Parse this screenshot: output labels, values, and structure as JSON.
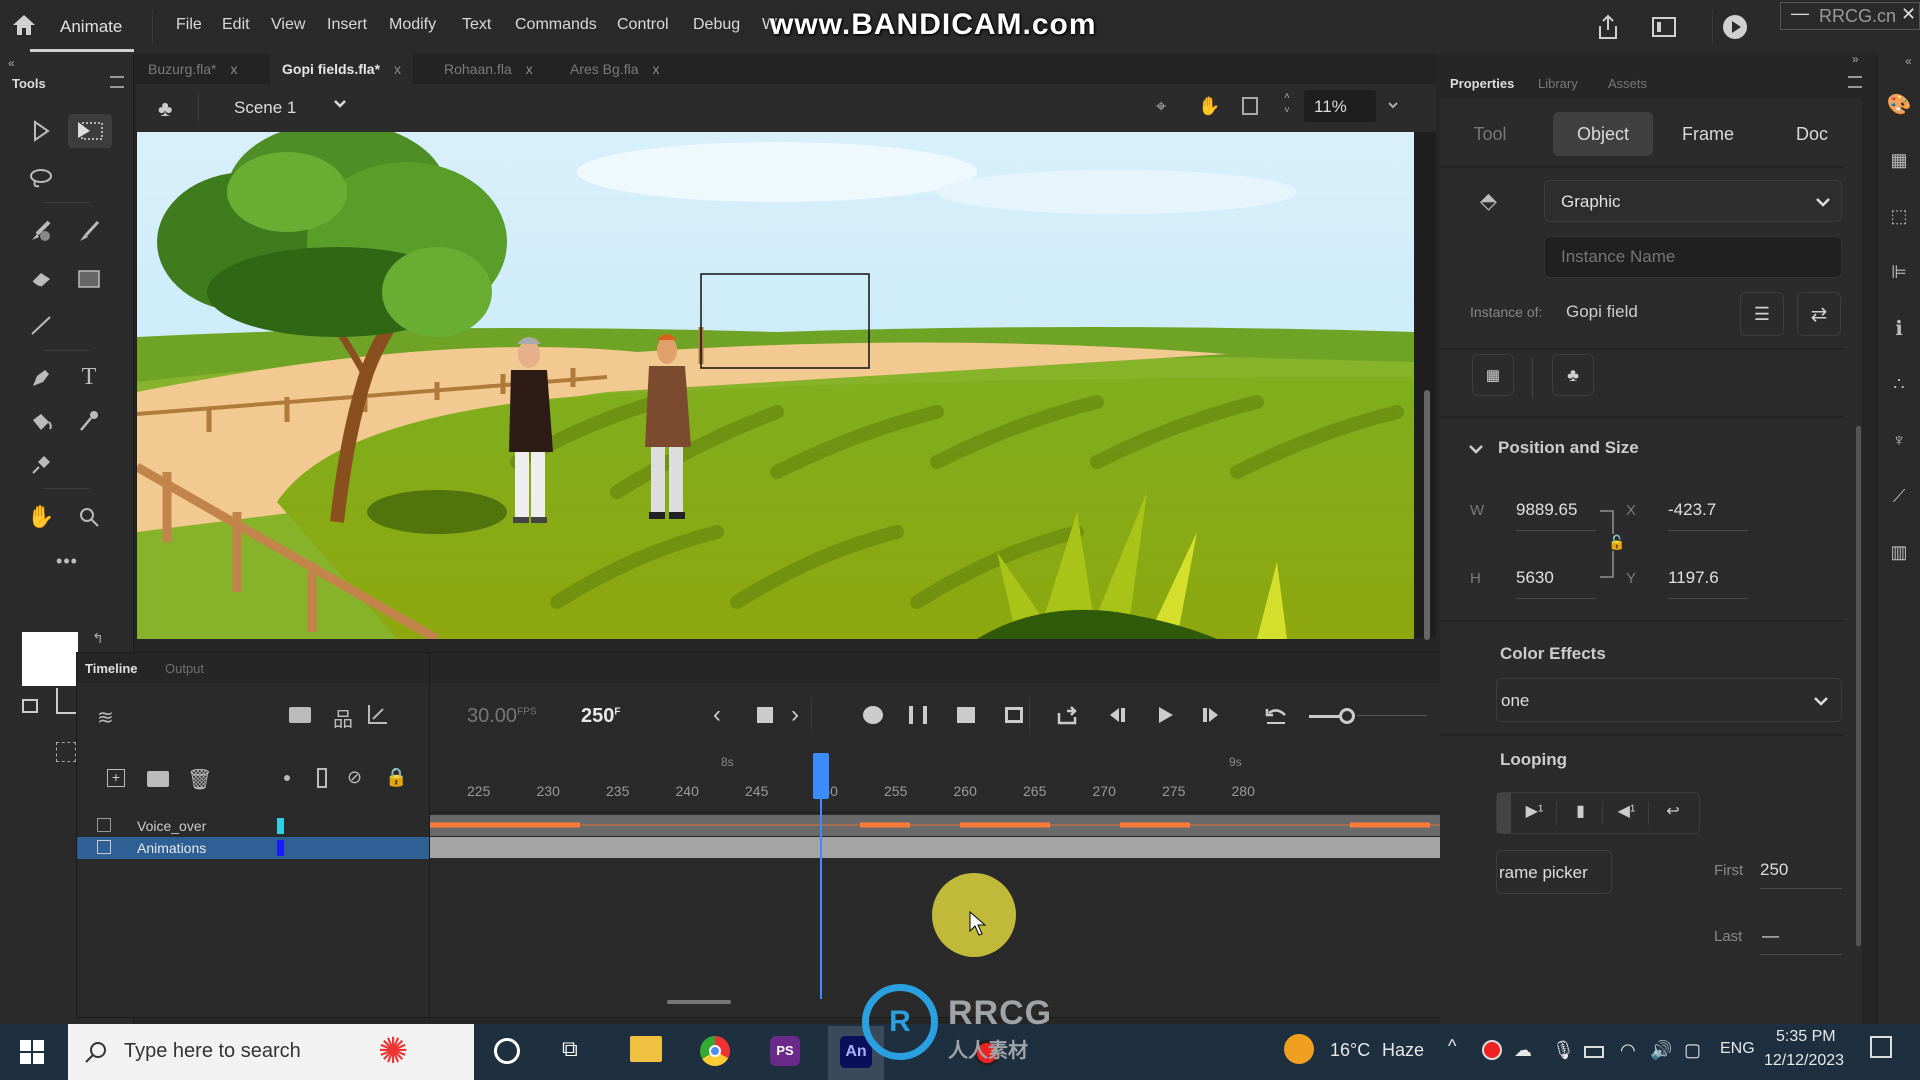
{
  "app": {
    "name": "Animate",
    "menu": [
      "File",
      "Edit",
      "View",
      "Insert",
      "Modify",
      "Text",
      "Commands",
      "Control",
      "Debug",
      "W"
    ],
    "watermark": "www.BANDICAM.com",
    "corner_watermark": "RRCG.cn"
  },
  "tools_panel": {
    "title": "Tools"
  },
  "doc_tabs": [
    {
      "label": "Buzurg.fla*",
      "active": false
    },
    {
      "label": "Gopi fields.fla*",
      "active": true
    },
    {
      "label": "Rohaan.fla",
      "active": false
    },
    {
      "label": "Ares Bg.fla",
      "active": false
    }
  ],
  "scene": {
    "label": "Scene 1",
    "zoom": "11%"
  },
  "timeline": {
    "tabs": [
      "Timeline",
      "Output"
    ],
    "fps": "30.00",
    "fps_unit": "FPS",
    "frame": "250",
    "frame_unit": "F",
    "seconds_markers": [
      "8s",
      "9s"
    ],
    "frame_ticks": [
      "225",
      "230",
      "235",
      "240",
      "245",
      "250",
      "255",
      "260",
      "265",
      "270",
      "275",
      "280"
    ],
    "current_frame": 250,
    "layers": [
      {
        "name": "Voice_over",
        "color": "#2fd0e6",
        "selected": false
      },
      {
        "name": "Animations",
        "color": "#1a1aff",
        "selected": true
      }
    ]
  },
  "properties": {
    "panel_tabs": [
      "Properties",
      "Library",
      "Assets"
    ],
    "tabs": [
      "Tool",
      "Object",
      "Frame",
      "Doc"
    ],
    "active_tab": "Object",
    "symbol_type": "Graphic",
    "instance_name_placeholder": "Instance Name",
    "instance_of_label": "Instance of:",
    "instance_of": "Gopi field",
    "position_size": {
      "title": "Position and Size",
      "w_label": "W",
      "w": "9889.65",
      "h_label": "H",
      "h": "5630",
      "x_label": "X",
      "x": "-423.7",
      "y_label": "Y",
      "y": "1197.6"
    },
    "color_effects": {
      "title": "Color Effects",
      "value": "one"
    },
    "looping": {
      "title": "Looping",
      "frame_picker": "rame picker",
      "first_label": "First",
      "first": "250",
      "last_label": "Last",
      "last": "—"
    }
  },
  "taskbar": {
    "search_placeholder": "Type here to search",
    "weather_temp": "16°C",
    "weather_desc": "Haze",
    "language": "ENG",
    "time": "5:35 PM",
    "date": "12/12/2023",
    "overlay_logo_top": "RRCG",
    "overlay_logo_bottom": "人人素材"
  }
}
